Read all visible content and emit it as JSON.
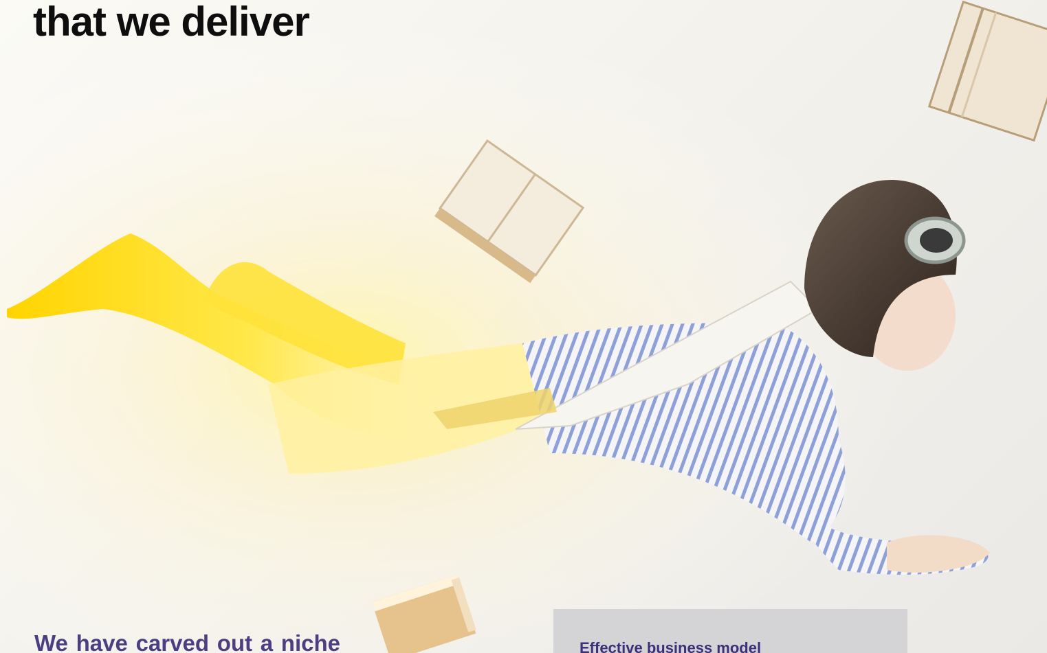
{
  "hero": {
    "title": "that we deliver"
  },
  "intro": {
    "text": "We have carved out a niche for ourselves in India’s"
  },
  "info_card": {
    "title": "Effective business model"
  },
  "colors": {
    "title": "#0e0e0e",
    "intro_text": "#4b3f82",
    "card_bg": "#d4d4d6",
    "card_title": "#3d2f7a",
    "glow": "#ffe600"
  }
}
